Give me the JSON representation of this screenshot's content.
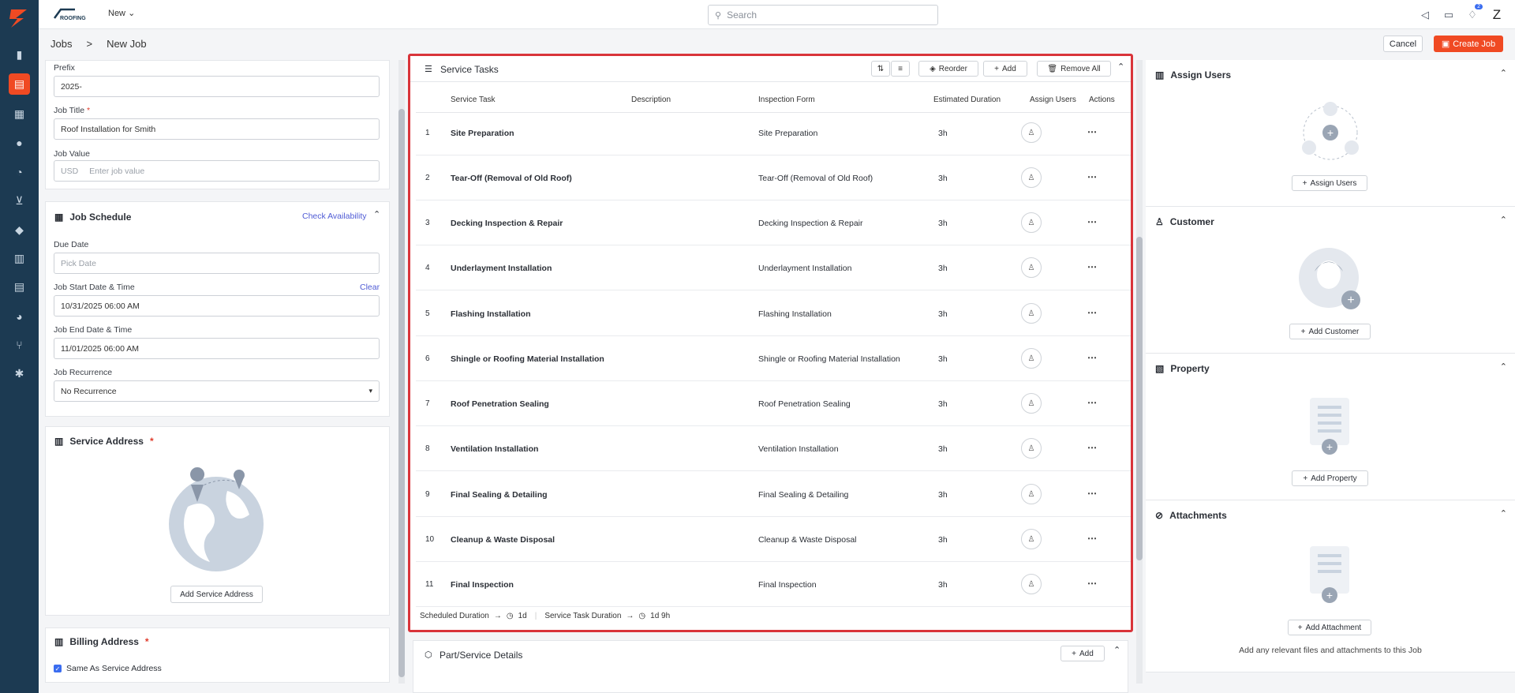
{
  "topbar": {
    "new_label": "New",
    "search_placeholder": "Search",
    "notif_count": "2",
    "avatar_letter": "Z"
  },
  "breadcrumb": {
    "root": "Jobs",
    "sep": ">",
    "current": "New Job"
  },
  "actions": {
    "cancel": "Cancel",
    "create": "Create Job"
  },
  "form": {
    "prefix_label": "Prefix",
    "prefix_value": "2025-",
    "title_label": "Job Title",
    "title_value": "Roof Installation for Smith",
    "value_label": "Job Value",
    "currency": "USD",
    "value_placeholder": "Enter job value"
  },
  "schedule": {
    "title": "Job Schedule",
    "check": "Check Availability",
    "due_label": "Due Date",
    "due_placeholder": "Pick Date",
    "start_label": "Job Start Date & Time",
    "clear": "Clear",
    "start_value": "10/31/2025 06:00 AM",
    "end_label": "Job End Date & Time",
    "end_value": "11/01/2025 06:00 AM",
    "rec_label": "Job Recurrence",
    "rec_value": "No Recurrence"
  },
  "service_address": {
    "title": "Service Address",
    "button": "Add Service Address"
  },
  "billing": {
    "title": "Billing Address",
    "same": "Same As Service Address"
  },
  "tasks": {
    "title": "Service Tasks",
    "reorder": "Reorder",
    "add": "Add",
    "remove_all": "Remove All",
    "columns": [
      "Service Task",
      "Description",
      "Inspection Form",
      "Estimated Duration",
      "Assign Users",
      "Actions"
    ],
    "rows": [
      {
        "num": "1",
        "name": "Site Preparation",
        "form": "Site Preparation",
        "dur": "3h"
      },
      {
        "num": "2",
        "name": "Tear-Off (Removal of Old Roof)",
        "form": "Tear-Off (Removal of Old Roof)",
        "dur": "3h"
      },
      {
        "num": "3",
        "name": "Decking Inspection & Repair",
        "form": "Decking Inspection & Repair",
        "dur": "3h"
      },
      {
        "num": "4",
        "name": "Underlayment Installation",
        "form": "Underlayment Installation",
        "dur": "3h"
      },
      {
        "num": "5",
        "name": "Flashing Installation",
        "form": "Flashing Installation",
        "dur": "3h"
      },
      {
        "num": "6",
        "name": "Shingle or Roofing Material Installation",
        "form": "Shingle or Roofing Material Installation",
        "dur": "3h"
      },
      {
        "num": "7",
        "name": "Roof Penetration Sealing",
        "form": "Roof Penetration Sealing",
        "dur": "3h"
      },
      {
        "num": "8",
        "name": "Ventilation Installation",
        "form": "Ventilation Installation",
        "dur": "3h"
      },
      {
        "num": "9",
        "name": "Final Sealing & Detailing",
        "form": "Final Sealing & Detailing",
        "dur": "3h"
      },
      {
        "num": "10",
        "name": "Cleanup & Waste Disposal",
        "form": "Cleanup & Waste Disposal",
        "dur": "3h"
      },
      {
        "num": "11",
        "name": "Final Inspection",
        "form": "Final Inspection",
        "dur": "3h"
      }
    ],
    "scheduled_label": "Scheduled Duration",
    "scheduled_value": "1d",
    "task_label": "Service Task Duration",
    "task_value": "1d 9h"
  },
  "parts": {
    "title": "Part/Service Details",
    "add": "Add"
  },
  "right": {
    "assign_title": "Assign Users",
    "assign_btn": "Assign Users",
    "customer_title": "Customer",
    "customer_btn": "Add Customer",
    "property_title": "Property",
    "property_btn": "Add Property",
    "attach_title": "Attachments",
    "attach_btn": "Add Attachment",
    "attach_note": "Add any relevant files and attachments to this Job"
  },
  "brand_text": "ROOFING",
  "colors": {
    "accent": "#f04a23",
    "nav": "#1c3a52",
    "highlight": "#d9343a",
    "link": "#4f5bd5"
  }
}
